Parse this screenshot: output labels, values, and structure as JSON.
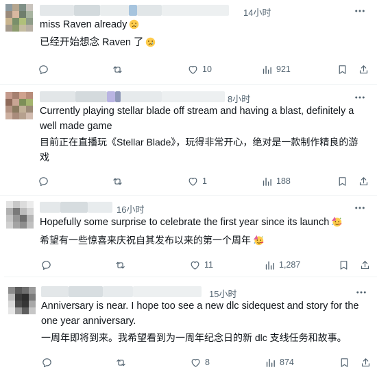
{
  "posts": [
    {
      "time": "14小时",
      "text_lines": [
        "miss Raven already"
      ],
      "translation_lines": [
        "已经开始想念 Raven 了"
      ],
      "text_emoji": "sad-tear-emoji",
      "translation_emoji": "sad-tear-emoji",
      "actions": {
        "replies": "",
        "reposts": "",
        "likes": "10",
        "views": "921"
      }
    },
    {
      "time": "8小时",
      "text_lines": [
        "Currently playing stellar blade off stream and having a blast, definitely a",
        "well made game"
      ],
      "translation_lines": [
        "目前正在直播玩《Stellar Blade》，玩得非常开心，绝对是一款制作精良的游",
        "戏"
      ],
      "actions": {
        "replies": "",
        "reposts": "",
        "likes": "1",
        "views": "188"
      }
    },
    {
      "time": "16小时",
      "text_lines": [
        "Hopefully some surprise to celebrate the first year since its launch"
      ],
      "translation_lines": [
        "希望有一些惊喜来庆祝自其发布以来的第一个周年"
      ],
      "text_emoji": "party-face-emoji",
      "translation_emoji": "party-face-emoji",
      "actions": {
        "replies": "",
        "reposts": "",
        "likes": "11",
        "views": "1,287"
      }
    },
    {
      "time": "15小时",
      "text_lines": [
        "Anniversary is near. I hope too see a new dlc sidequest and story for the",
        "one year anniversary."
      ],
      "translation_lines": [
        "一周年即将到来。我希望看到为一周年纪念日的新 dlc 支线任务和故事。"
      ],
      "actions": {
        "replies": "",
        "reposts": "",
        "likes": "8",
        "views": "874"
      }
    }
  ],
  "colors": {
    "text": "#0f1419",
    "muted": "#536471",
    "divider": "#eff3f4"
  }
}
